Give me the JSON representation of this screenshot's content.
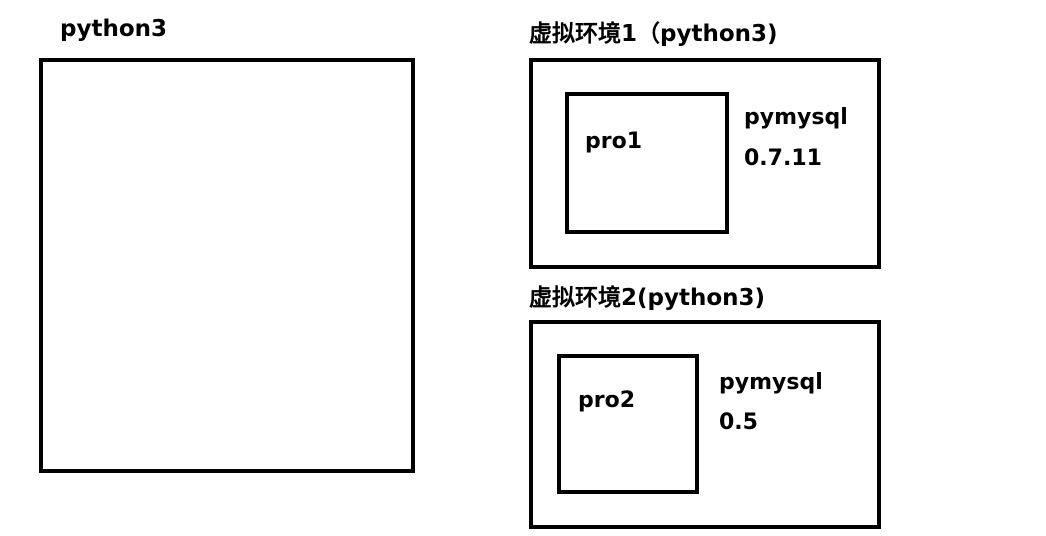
{
  "system": {
    "title": "python3"
  },
  "env1": {
    "title": "虚拟环境1（python3)",
    "project": "pro1",
    "package": "pymysql",
    "version": "0.7.11"
  },
  "env2": {
    "title": "虚拟环境2(python3)",
    "project": "pro2",
    "package": "pymysql",
    "version": "0.5"
  },
  "colors": {
    "stroke": "#000000",
    "background": "#ffffff"
  }
}
